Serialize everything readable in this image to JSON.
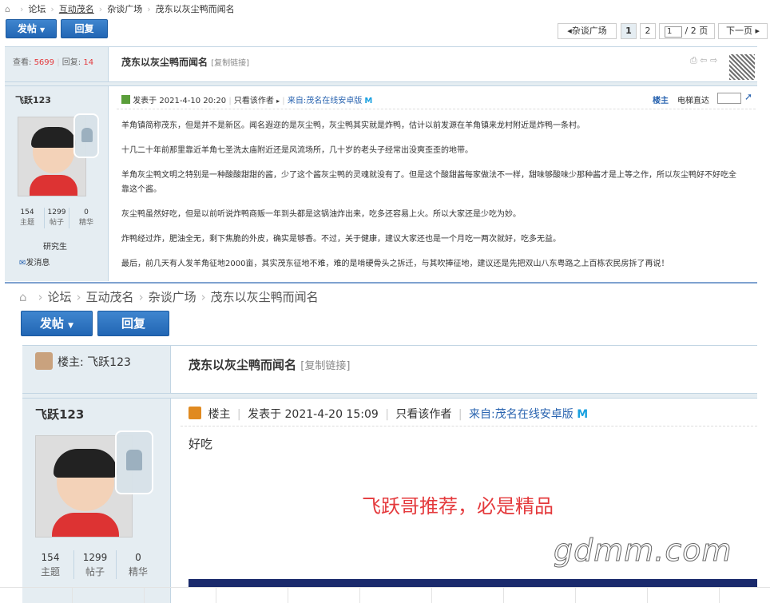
{
  "top": {
    "breadcrumb": [
      "论坛",
      "互动茂名",
      "杂谈广场",
      "茂东以灰尘鸭而闻名"
    ],
    "post_button": "发帖",
    "reply_button": "回复",
    "pager": {
      "prev_label": "杂谈广场",
      "pages": [
        "1",
        "2"
      ],
      "current_page_input": "1",
      "total": "/ 2 页",
      "next_label": "下一页"
    },
    "stats": {
      "views_label": "查看:",
      "views": "5699",
      "replies_label": "回复:",
      "replies": "14"
    },
    "thread_title": "茂东以灰尘鸭而闻名",
    "copy_link": "[复制链接]",
    "author": {
      "name": "飞跃123",
      "stats": [
        {
          "value": "154",
          "label": "主题"
        },
        {
          "value": "1299",
          "label": "帖子"
        },
        {
          "value": "0",
          "label": "精华"
        }
      ],
      "rank": "研究生",
      "message_link": "发消息"
    },
    "post_meta": {
      "posted": "发表于 2021-4-10 20:20",
      "only_author": "只看该作者",
      "source": "来自:茂名在线安卓版",
      "floor": "楼主",
      "elevator": "电梯直达"
    },
    "paragraphs": [
      "羊角镇简称茂东，但是并不是新区。闻名遐迩的是灰尘鸭，灰尘鸭其实就是炸鸭，估计以前发源在羊角镇来龙村附近是炸鸭一条村。",
      "十几二十年前那里靠近羊角七圣洗太庙附近还是风流场所，几十岁的老头子经常出没爽歪歪的地带。",
      "羊角灰尘鸭文明之特别是一种酸酸甜甜的酱，少了这个酱灰尘鸭的灵魂就没有了。但是这个酸甜酱每家做法不一样，甜味够酸味少那种酱才是上等之作，所以灰尘鸭好不好吃全靠这个酱。",
      "灰尘鸭虽然好吃，但是以前听说炸鸭商贩一年到头都是这锅油炸出来，吃多还容易上火。所以大家还是少吃为妙。",
      "炸鸭经过炸，肥油全无，剩下焦脆的外皮，确实是够香。不过，关于健康，建议大家还也是一个月吃一两次就好，吃多无益。",
      "最后，前几天有人发羊角征地2000亩，其实茂东征地不难，难的是啃硬骨头之拆迁，与其吹捧征地，建议还是先把双山八东粤路之上百栋农民房拆了再说！"
    ]
  },
  "bottom": {
    "breadcrumb": [
      "论坛",
      "互动茂名",
      "杂谈广场",
      "茂东以灰尘鸭而闻名"
    ],
    "post_button": "发帖",
    "reply_button": "回复",
    "op_label": "楼主: 飞跃123",
    "thread_title": "茂东以灰尘鸭而闻名",
    "copy_link": "[复制链接]",
    "author": {
      "name": "飞跃123",
      "stats": [
        {
          "value": "154",
          "label": "主题"
        },
        {
          "value": "1299",
          "label": "帖子"
        },
        {
          "value": "0",
          "label": "精华"
        }
      ]
    },
    "post_meta": {
      "floor": "楼主",
      "posted": "发表于 2021-4-20 15:09",
      "only_author": "只看该作者",
      "source": "来自:茂名在线安卓版"
    },
    "body": "好吃",
    "recommend": "飞跃哥推荐，必是精品",
    "watermark": "gdmm.com"
  },
  "colors": {
    "accent_blue": "#2a64b0",
    "button_blue": "#2a6fbf",
    "red": "#e4393c"
  }
}
